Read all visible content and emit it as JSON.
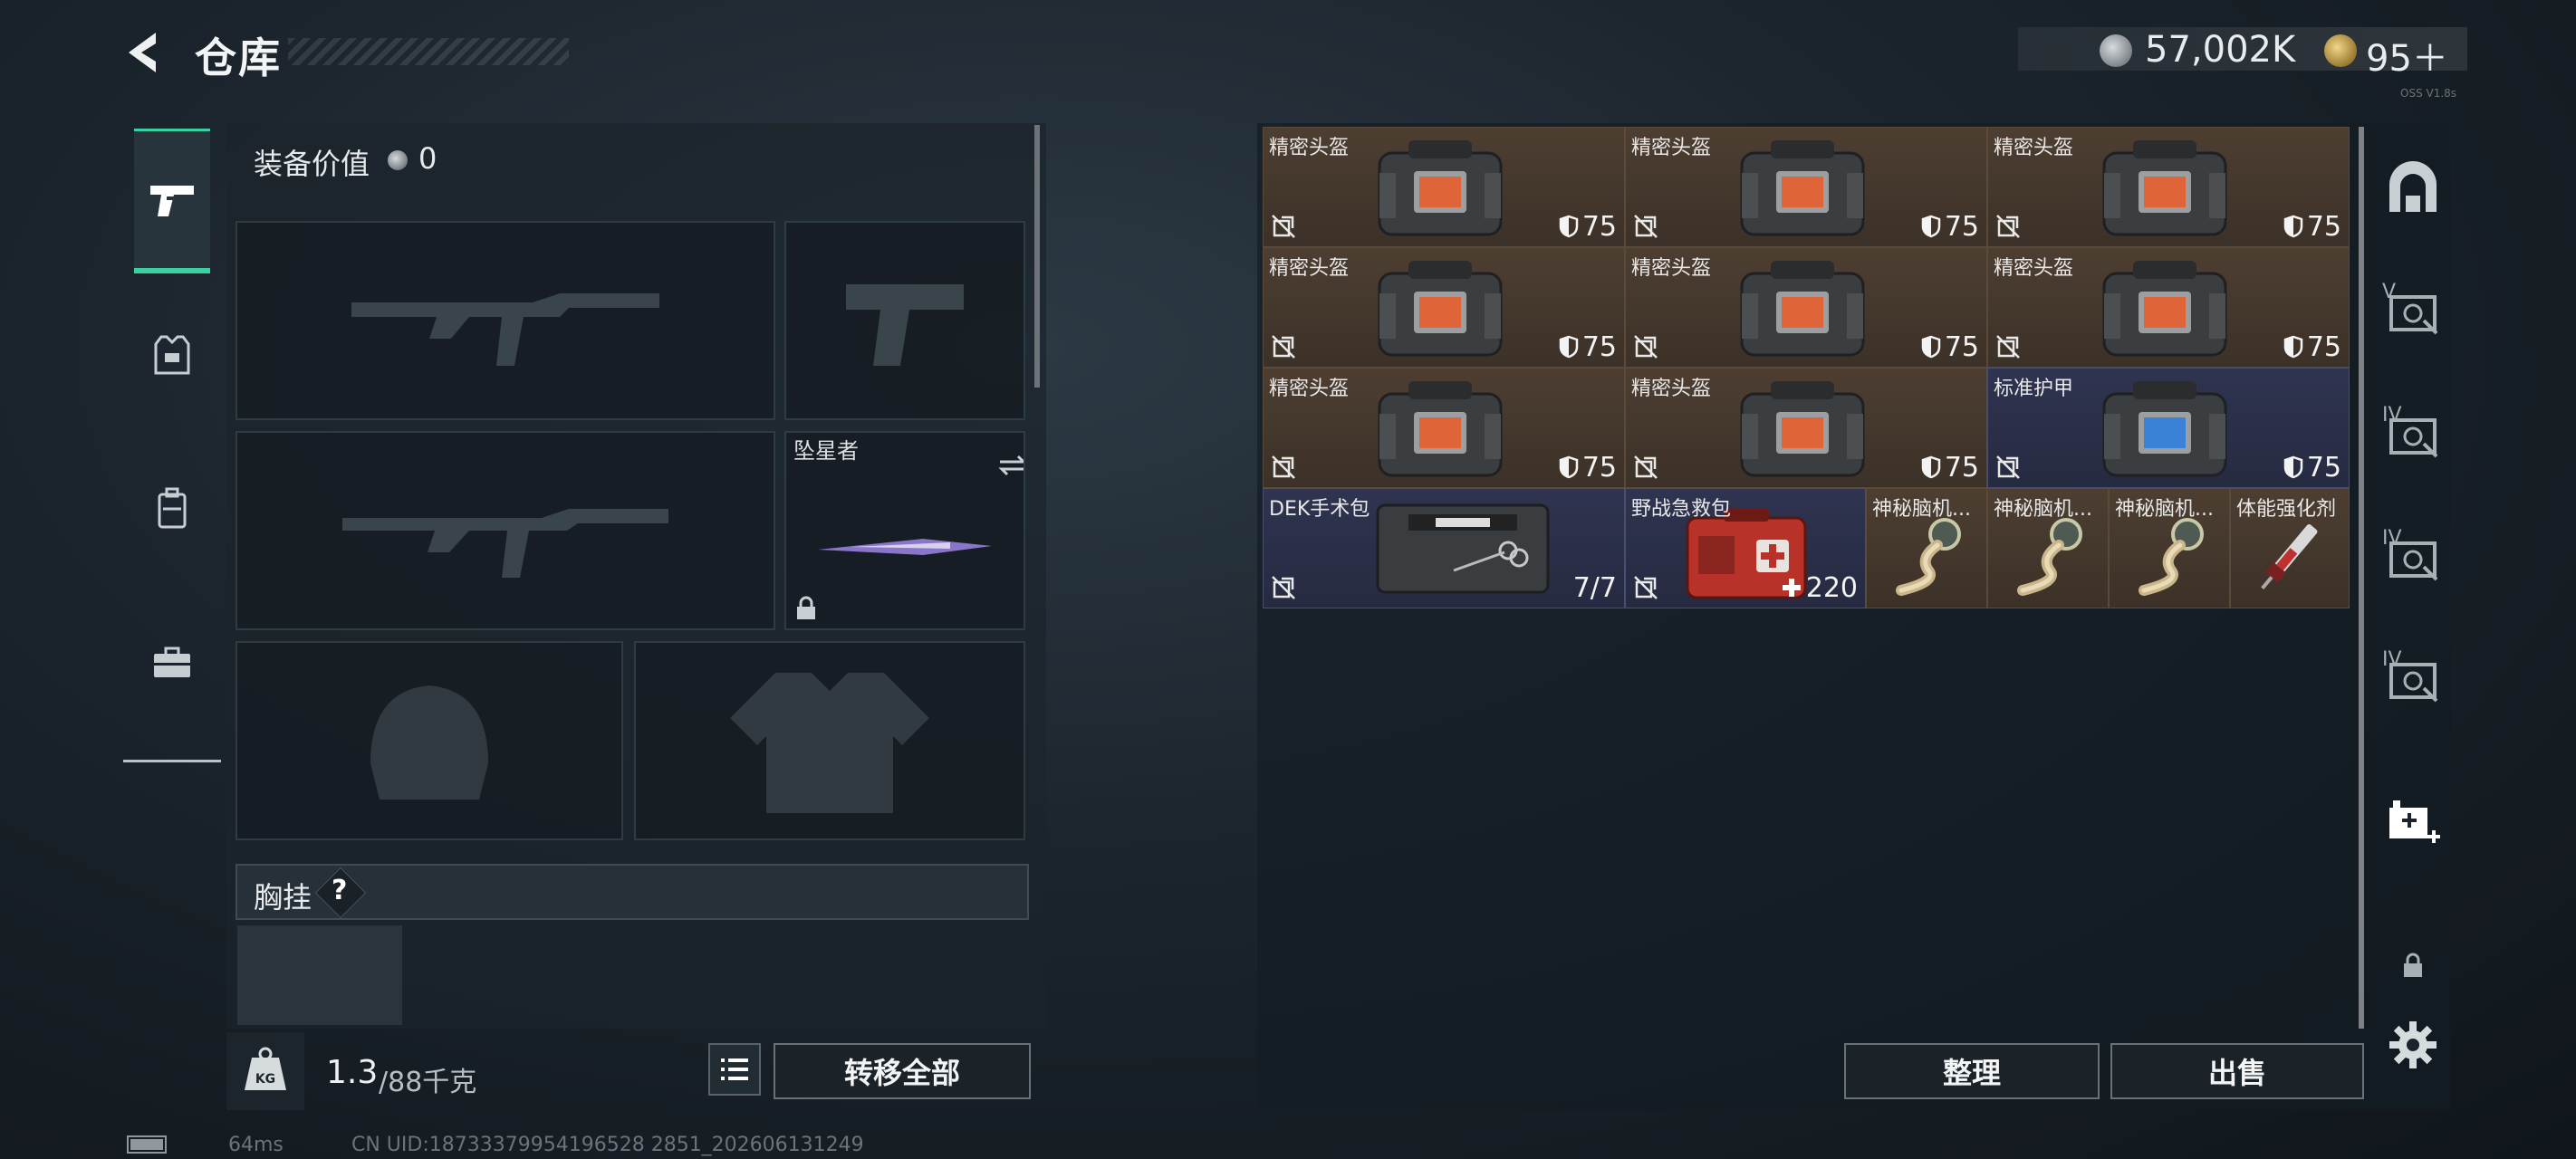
{
  "header": {
    "title": "仓库",
    "silver_amount": "57,002K",
    "gold_amount": "95＋",
    "ver_text": "OSS V1.8s"
  },
  "left_tabs": [
    {
      "name": "weapons",
      "icon": "pistol-icon",
      "active": true
    },
    {
      "name": "armor",
      "icon": "armor-vest-icon",
      "active": false
    },
    {
      "name": "backpack",
      "icon": "backpack-icon",
      "active": false
    },
    {
      "name": "case",
      "icon": "briefcase-icon",
      "active": false
    }
  ],
  "equipment": {
    "value_label": "装备价值",
    "value": "0",
    "melee_name": "坠星者",
    "chest_rig_label": "胸挂",
    "chest_rig_help": "?"
  },
  "bottom_left": {
    "weight_icon_text": "KG",
    "weight_value": "1.3",
    "weight_cap": "/88千克",
    "transfer_all_label": "转移全部"
  },
  "stash": {
    "items": [
      {
        "name": "精密头盔",
        "durability": "75",
        "tier": "brown",
        "icon": "helmet-case-icon"
      },
      {
        "name": "精密头盔",
        "durability": "75",
        "tier": "brown",
        "icon": "helmet-case-icon"
      },
      {
        "name": "精密头盔",
        "durability": "75",
        "tier": "brown",
        "icon": "helmet-case-icon"
      },
      {
        "name": "精密头盔",
        "durability": "75",
        "tier": "brown",
        "icon": "helmet-case-icon"
      },
      {
        "name": "精密头盔",
        "durability": "75",
        "tier": "brown",
        "icon": "helmet-case-icon"
      },
      {
        "name": "精密头盔",
        "durability": "75",
        "tier": "brown",
        "icon": "helmet-case-icon"
      },
      {
        "name": "精密头盔",
        "durability": "75",
        "tier": "brown",
        "icon": "helmet-case-icon"
      },
      {
        "name": "精密头盔",
        "durability": "75",
        "tier": "brown",
        "icon": "helmet-case-icon"
      },
      {
        "name": "标准护甲",
        "durability": "75",
        "tier": "blue",
        "icon": "armor-case-icon"
      },
      {
        "name": "DEK手术包",
        "durability": "7/7",
        "tier": "blue",
        "icon": "surgery-kit-icon"
      },
      {
        "name": "野战急救包",
        "durability": "220",
        "tier": "blue",
        "icon": "first-aid-kit-icon"
      },
      {
        "name": "神秘脑机...",
        "durability": "",
        "tier": "brown",
        "icon": "neural-chip-icon"
      },
      {
        "name": "神秘脑机...",
        "durability": "",
        "tier": "brown",
        "icon": "neural-chip-icon"
      },
      {
        "name": "神秘脑机...",
        "durability": "",
        "tier": "brown",
        "icon": "neural-chip-icon"
      },
      {
        "name": "体能强化剂",
        "durability": "",
        "tier": "brown",
        "icon": "stim-injector-icon"
      }
    ],
    "sort_label": "整理",
    "sell_label": "出售"
  },
  "side_tabs": [
    {
      "icon": "arch-icon",
      "label": ""
    },
    {
      "icon": "safe-v-icon",
      "label": "V"
    },
    {
      "icon": "safe-iv-icon",
      "label": "IV"
    },
    {
      "icon": "safe-iv-icon",
      "label": "IV"
    },
    {
      "icon": "safe-iv-icon",
      "label": "IV"
    },
    {
      "icon": "add-stash-icon",
      "label": ""
    },
    {
      "icon": "lock-icon",
      "label": ""
    },
    {
      "icon": "gear-icon",
      "label": ""
    }
  ],
  "status": {
    "ping": "64ms",
    "uid": "CN UID:18733379954196528 2851_202606131249"
  },
  "colors": {
    "accent": "#3ad0a0",
    "tier_brown": "#4d3e31",
    "tier_blue": "#2f3450"
  }
}
